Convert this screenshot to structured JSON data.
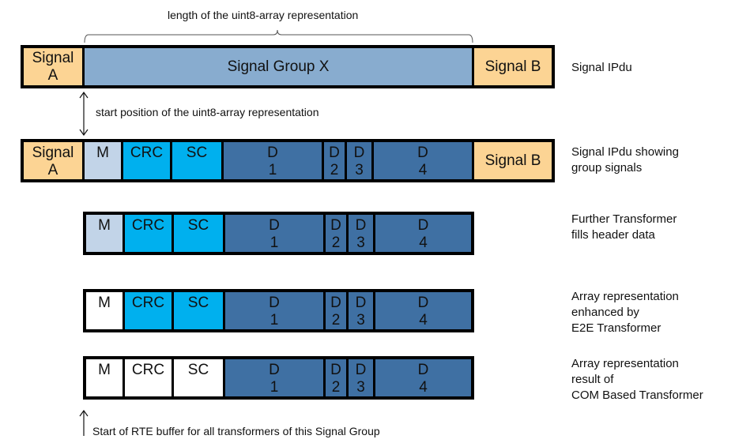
{
  "annotations": {
    "length_label": "length of the uint8-array representation",
    "start_position_label": "start position of the uint8-array representation",
    "rte_buffer_label": "Start of RTE buffer for all transformers of this Signal Group"
  },
  "rows": [
    {
      "caption": [
        "Signal IPdu"
      ],
      "cells": [
        {
          "label": [
            "Signal",
            "A"
          ],
          "color": "#fcd494"
        },
        {
          "label": [
            "Signal Group X"
          ],
          "color": "#88accf"
        },
        {
          "label": [
            "Signal B"
          ],
          "color": "#fcd494"
        }
      ]
    },
    {
      "caption": [
        "Signal IPdu showing",
        "group signals"
      ],
      "cells": [
        {
          "label": [
            "Signal",
            "A"
          ],
          "color": "#fcd494"
        },
        {
          "label": [
            "M"
          ],
          "color": "#c2d4e8"
        },
        {
          "label": [
            "CRC"
          ],
          "color": "#00b0ee"
        },
        {
          "label": [
            "SC"
          ],
          "color": "#00b0ee"
        },
        {
          "label": [
            "D",
            "1"
          ],
          "color": "#3f70a3"
        },
        {
          "label": [
            "D",
            "2"
          ],
          "color": "#3f70a3"
        },
        {
          "label": [
            "D",
            "3"
          ],
          "color": "#3f70a3"
        },
        {
          "label": [
            "D",
            "4"
          ],
          "color": "#3f70a3"
        },
        {
          "label": [
            "Signal B"
          ],
          "color": "#fcd494"
        }
      ]
    },
    {
      "caption": [
        "Further Transformer",
        "fills header data"
      ],
      "cells": [
        {
          "label": [
            "M"
          ],
          "color": "#c2d4e8"
        },
        {
          "label": [
            "CRC"
          ],
          "color": "#00b0ee"
        },
        {
          "label": [
            "SC"
          ],
          "color": "#00b0ee"
        },
        {
          "label": [
            "D",
            "1"
          ],
          "color": "#3f70a3"
        },
        {
          "label": [
            "D",
            "2"
          ],
          "color": "#3f70a3"
        },
        {
          "label": [
            "D",
            "3"
          ],
          "color": "#3f70a3"
        },
        {
          "label": [
            "D",
            "4"
          ],
          "color": "#3f70a3"
        }
      ]
    },
    {
      "caption": [
        "Array representation",
        "enhanced by",
        "E2E Transformer"
      ],
      "cells": [
        {
          "label": [
            "M"
          ],
          "color": "#ffffff"
        },
        {
          "label": [
            "CRC"
          ],
          "color": "#00b0ee"
        },
        {
          "label": [
            "SC"
          ],
          "color": "#00b0ee"
        },
        {
          "label": [
            "D",
            "1"
          ],
          "color": "#3f70a3"
        },
        {
          "label": [
            "D",
            "2"
          ],
          "color": "#3f70a3"
        },
        {
          "label": [
            "D",
            "3"
          ],
          "color": "#3f70a3"
        },
        {
          "label": [
            "D",
            "4"
          ],
          "color": "#3f70a3"
        }
      ]
    },
    {
      "caption": [
        "Array representation",
        "result of",
        "COM Based Transformer"
      ],
      "cells": [
        {
          "label": [
            "M"
          ],
          "color": "#ffffff"
        },
        {
          "label": [
            "CRC"
          ],
          "color": "#ffffff"
        },
        {
          "label": [
            "SC"
          ],
          "color": "#ffffff"
        },
        {
          "label": [
            "D",
            "1"
          ],
          "color": "#3f70a3"
        },
        {
          "label": [
            "D",
            "2"
          ],
          "color": "#3f70a3"
        },
        {
          "label": [
            "D",
            "3"
          ],
          "color": "#3f70a3"
        },
        {
          "label": [
            "D",
            "4"
          ],
          "color": "#3f70a3"
        }
      ]
    }
  ]
}
